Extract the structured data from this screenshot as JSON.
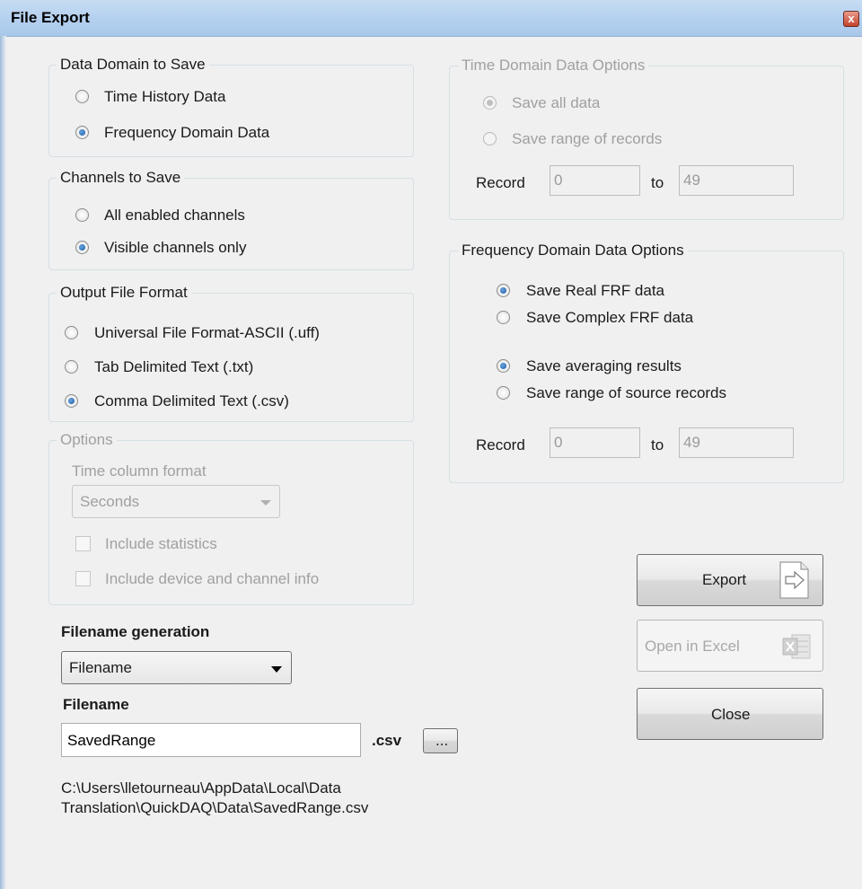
{
  "window": {
    "title": "File Export",
    "close_glyph": "x"
  },
  "data_domain": {
    "legend": "Data Domain to Save",
    "options": [
      {
        "label": "Time History Data",
        "checked": false
      },
      {
        "label": "Frequency Domain Data",
        "checked": true
      }
    ]
  },
  "channels": {
    "legend": "Channels to Save",
    "options": [
      {
        "label": "All enabled channels",
        "checked": false
      },
      {
        "label": "Visible channels only",
        "checked": true
      }
    ]
  },
  "output_format": {
    "legend": "Output File Format",
    "options": [
      {
        "label": "Universal File Format-ASCII (.uff)",
        "checked": false
      },
      {
        "label": "Tab Delimited Text (.txt)",
        "checked": false
      },
      {
        "label": "Comma Delimited Text (.csv)",
        "checked": true
      }
    ]
  },
  "options_group": {
    "legend": "Options",
    "time_column_label": "Time column format",
    "time_column_value": "Seconds",
    "include_statistics": "Include statistics",
    "include_device_info": "Include device and channel info"
  },
  "time_domain": {
    "legend": "Time Domain Data Options",
    "save_all": "Save all data",
    "save_range": "Save range of records",
    "record_label": "Record",
    "from_value": "0",
    "to_label": "to",
    "to_value": "49"
  },
  "freq_domain": {
    "legend": "Frequency Domain Data Options",
    "save_real": "Save Real FRF data",
    "save_complex": "Save Complex FRF data",
    "save_averaging": "Save averaging results",
    "save_source_range": "Save range of source records",
    "record_label": "Record",
    "from_value": "0",
    "to_label": "to",
    "to_value": "49"
  },
  "filename_generation": {
    "label": "Filename generation",
    "value": "Filename"
  },
  "filename": {
    "label": "Filename",
    "value": "SavedRange",
    "extension": ".csv",
    "browse_label": "...",
    "path_line1": "C:\\Users\\lletourneau\\AppData\\Local\\Data",
    "path_line2": "Translation\\QuickDAQ\\Data\\SavedRange.csv"
  },
  "buttons": {
    "export": "Export",
    "open_excel": "Open in Excel",
    "close": "Close"
  },
  "icons": {
    "export": "export-icon",
    "excel": "excel-icon",
    "dropdown": "chevron-down-icon"
  }
}
